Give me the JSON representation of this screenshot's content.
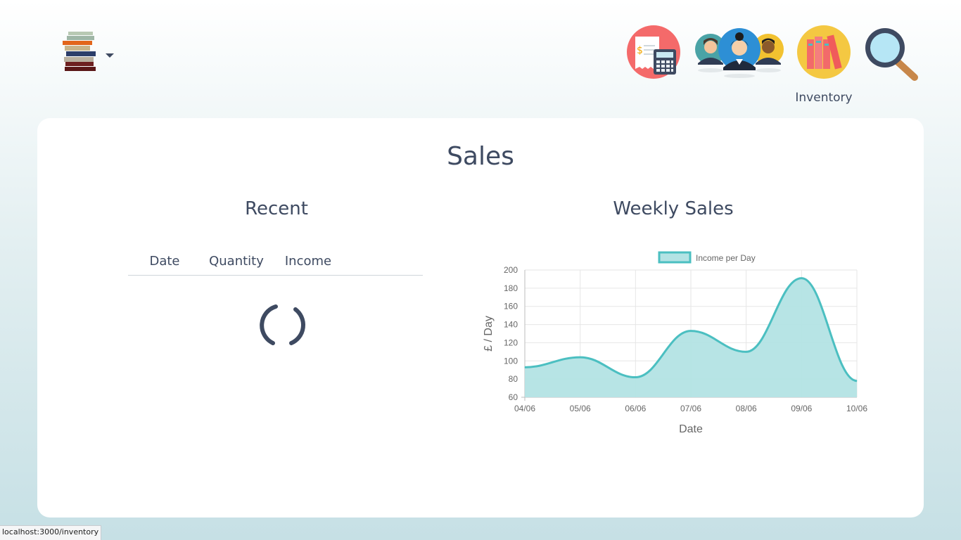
{
  "header": {
    "logo_icon": "books-stack-icon",
    "menu_icon": "caret-down-icon",
    "nav": [
      {
        "icon": "receipt-calculator-icon",
        "label": ""
      },
      {
        "icon": "staff-people-icon",
        "label": ""
      },
      {
        "icon": "books-inventory-icon",
        "label": "Inventory"
      },
      {
        "icon": "magnifier-search-icon",
        "label": ""
      }
    ],
    "hover_label": "Inventory"
  },
  "page": {
    "title": "Sales"
  },
  "recent": {
    "title": "Recent",
    "columns": [
      "Date",
      "Quantity",
      "Income"
    ],
    "rows": [],
    "loading_icon": "loading-spinner-icon"
  },
  "weekly": {
    "title": "Weekly Sales"
  },
  "chart_data": {
    "type": "area",
    "title": "",
    "xlabel": "Date",
    "ylabel": "£ / Day",
    "categories": [
      "04/06",
      "05/06",
      "06/06",
      "07/06",
      "08/06",
      "09/06",
      "10/06"
    ],
    "series": [
      {
        "name": "Income per Day",
        "values": [
          93,
          104,
          82,
          133,
          110,
          191,
          78
        ],
        "color": "#4bbfc1",
        "fill": "#b3e3e4"
      }
    ],
    "ylim": [
      60,
      200
    ],
    "yticks": [
      60,
      80,
      100,
      120,
      140,
      160,
      180,
      200
    ],
    "grid": true,
    "legend": "top"
  },
  "status_bar": {
    "url": "localhost:3000/inventory"
  },
  "colors": {
    "text": "#3e4a61",
    "accent": "#4bbfc1",
    "card": "#ffffff"
  }
}
